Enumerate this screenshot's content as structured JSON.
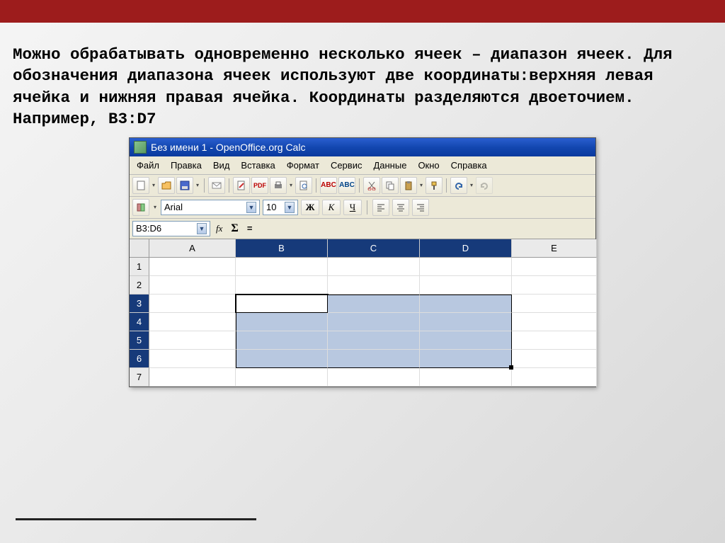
{
  "slide": {
    "paragraph": "Можно обрабатывать одновременно несколько ячеек – диапазон ячеек. Для обозначения диапазона ячеек используют две координаты:верхняя левая ячейка и нижняя правая ячейка. Координаты разделяются двоеточием. Например, B3:D7"
  },
  "window": {
    "title": "Без имени 1 - OpenOffice.org Calc"
  },
  "menu": {
    "file": "Файл",
    "edit": "Правка",
    "view": "Вид",
    "insert": "Вставка",
    "format": "Формат",
    "tools": "Сервис",
    "data": "Данные",
    "window": "Окно",
    "help": "Справка"
  },
  "format_bar": {
    "font_name": "Arial",
    "font_size": "10",
    "bold": "Ж",
    "italic": "К",
    "underline": "Ч"
  },
  "formula_bar": {
    "name_box": "B3:D6",
    "fx": "fx",
    "sigma": "Σ",
    "eq": "="
  },
  "columns": [
    "A",
    "B",
    "C",
    "D",
    "E"
  ],
  "rows": [
    "1",
    "2",
    "3",
    "4",
    "5",
    "6",
    "7"
  ],
  "selection": {
    "active": "B3",
    "cols": [
      "B",
      "C",
      "D"
    ],
    "rows": [
      "3",
      "4",
      "5",
      "6"
    ]
  },
  "icons": {
    "new": "new",
    "open": "open",
    "save": "save",
    "mail": "mail",
    "edit": "edit",
    "pdf": "pdf",
    "print": "print",
    "preview": "preview",
    "spell": "spell",
    "autospell": "autospell",
    "cut": "cut",
    "copy": "copy",
    "paste": "paste",
    "brush": "brush",
    "undo": "undo",
    "redo": "redo"
  }
}
